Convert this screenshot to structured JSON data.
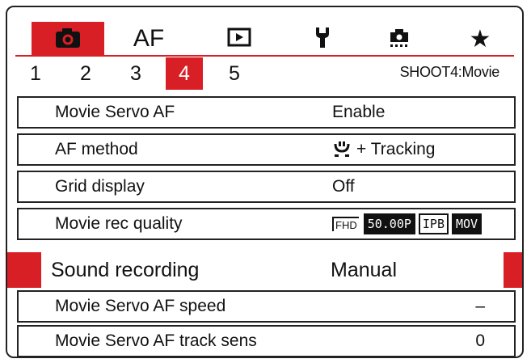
{
  "category_tabs": [
    {
      "icon": "camera-icon",
      "label": ""
    },
    {
      "icon": "",
      "label": "AF"
    },
    {
      "icon": "playback-icon",
      "label": ""
    },
    {
      "icon": "wrench-icon",
      "label": ""
    },
    {
      "icon": "custom-function-icon",
      "label": ""
    },
    {
      "icon": "star-icon",
      "label": "★"
    }
  ],
  "number_tabs": [
    "1",
    "2",
    "3",
    "4",
    "5"
  ],
  "active_number_tab": "4",
  "page_id": "SHOOT4:Movie",
  "rows": [
    {
      "name": "Movie Servo AF",
      "value": "Enable"
    },
    {
      "name": "AF method",
      "value": "+ Tracking"
    },
    {
      "name": "Grid display",
      "value": "Off"
    },
    {
      "name": "Movie rec quality",
      "value": "",
      "badges": {
        "size": "FHD",
        "rate": "50.00P",
        "compression": "IPB",
        "format": "MOV"
      }
    },
    {
      "name": "Sound recording",
      "value": "Manual"
    },
    {
      "name": "Movie Servo AF speed",
      "value": "–"
    },
    {
      "name": "Movie Servo AF track sens",
      "value": "0"
    }
  ],
  "colors": {
    "accent": "#d91f26",
    "text": "#111111",
    "background": "#ffffff"
  }
}
